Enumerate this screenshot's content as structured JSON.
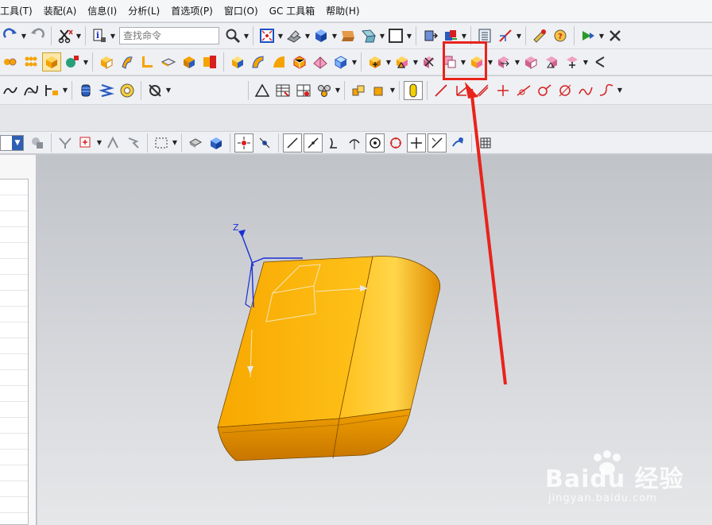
{
  "menubar": {
    "items": [
      "工具(T)",
      "装配(A)",
      "信息(I)",
      "分析(L)",
      "首选项(P)",
      "窗口(O)",
      "GC 工具箱",
      "帮助(H)"
    ]
  },
  "toolbar": {
    "search_placeholder": "查找命令",
    "row1_icons": [
      "redo-icon",
      "undo-icon",
      "cut-icon",
      "info-icon",
      "find-icon",
      "fit-view-icon",
      "shading-icon",
      "cube-view-icon",
      "background-icon",
      "window-icon",
      "assembly-icon"
    ],
    "row2_icons": [
      "feature-icon",
      "block-icon",
      "cylinder-icon",
      "extrude-icon",
      "revolve-icon",
      "sweep-icon",
      "hole-icon",
      "boss-icon",
      "pocket-icon",
      "pad-icon",
      "offset-face-icon"
    ],
    "highlighted_tool": "offset-region-icon",
    "row3_icons": [
      "sketch-icon",
      "spring-icon",
      "nut-icon",
      "gear-icon",
      "triangle-icon",
      "table-icon",
      "curve-icon",
      "line-icon"
    ]
  },
  "graphics": {
    "axis_label": "Z"
  },
  "watermark": {
    "brand": "Baidu 经验",
    "url": "jingyan.baidu.com"
  },
  "colors": {
    "highlight": "#e8231b",
    "model_orange": "#f5a300",
    "axis_blue": "#1a2fd6"
  }
}
